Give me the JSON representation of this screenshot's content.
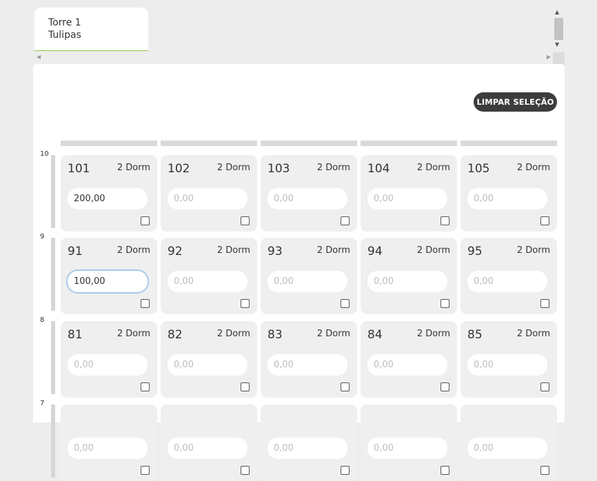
{
  "tab": {
    "line1": "Torre 1",
    "line2": "Tulipas"
  },
  "toolbar": {
    "clear_label": "LIMPAR SELEÇÃO"
  },
  "placeholder": "0,00",
  "floors": [
    {
      "label": "10",
      "units": [
        {
          "number": "101",
          "type": "2 Dorm",
          "value": "200,00"
        },
        {
          "number": "102",
          "type": "2 Dorm",
          "value": ""
        },
        {
          "number": "103",
          "type": "2 Dorm",
          "value": ""
        },
        {
          "number": "104",
          "type": "2 Dorm",
          "value": ""
        },
        {
          "number": "105",
          "type": "2 Dorm",
          "value": ""
        }
      ]
    },
    {
      "label": "9",
      "units": [
        {
          "number": "91",
          "type": "2 Dorm",
          "value": "100,00"
        },
        {
          "number": "92",
          "type": "2 Dorm",
          "value": ""
        },
        {
          "number": "93",
          "type": "2 Dorm",
          "value": ""
        },
        {
          "number": "94",
          "type": "2 Dorm",
          "value": ""
        },
        {
          "number": "95",
          "type": "2 Dorm",
          "value": ""
        }
      ]
    },
    {
      "label": "8",
      "units": [
        {
          "number": "81",
          "type": "2 Dorm",
          "value": ""
        },
        {
          "number": "82",
          "type": "2 Dorm",
          "value": ""
        },
        {
          "number": "83",
          "type": "2 Dorm",
          "value": ""
        },
        {
          "number": "84",
          "type": "2 Dorm",
          "value": ""
        },
        {
          "number": "85",
          "type": "2 Dorm",
          "value": ""
        }
      ]
    },
    {
      "label": "7",
      "units": [
        {
          "number": "",
          "type": "",
          "value": ""
        },
        {
          "number": "",
          "type": "",
          "value": ""
        },
        {
          "number": "",
          "type": "",
          "value": ""
        },
        {
          "number": "",
          "type": "",
          "value": ""
        },
        {
          "number": "",
          "type": "",
          "value": ""
        }
      ]
    }
  ]
}
